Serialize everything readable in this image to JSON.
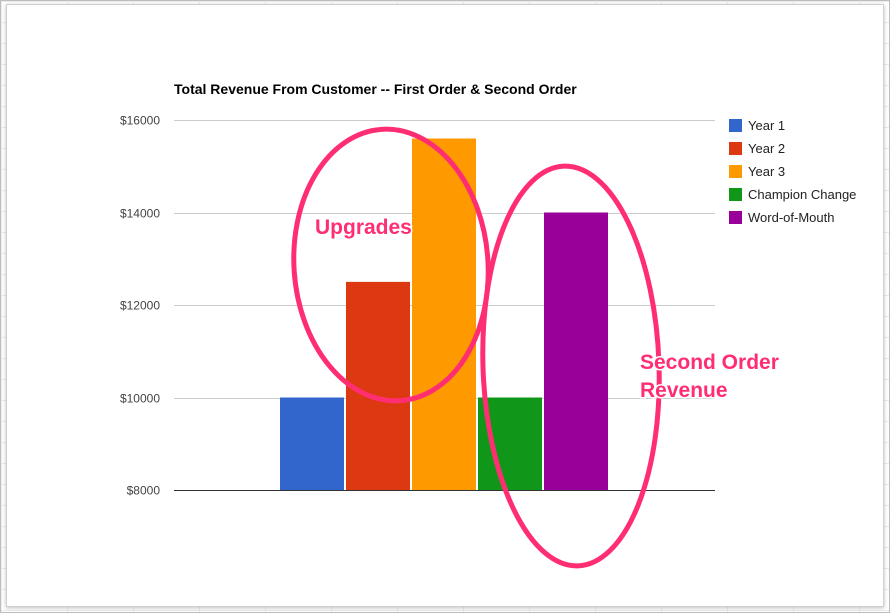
{
  "chart_data": {
    "type": "bar",
    "title": "Total Revenue From Customer -- First Order & Second Order",
    "xlabel": "",
    "ylabel": "",
    "ylim": [
      8000,
      16000
    ],
    "yticks": [
      8000,
      10000,
      12000,
      14000,
      16000
    ],
    "ytick_labels": [
      "$8000",
      "$10000",
      "$12000",
      "$14000",
      "$16000"
    ],
    "grid": true,
    "legend_position": "right",
    "series": [
      {
        "name": "Year 1",
        "value": 10000,
        "color": "#3366cc"
      },
      {
        "name": "Year 2",
        "value": 12500,
        "color": "#dc3912"
      },
      {
        "name": "Year 3",
        "value": 15600,
        "color": "#ff9900"
      },
      {
        "name": "Champion Change",
        "value": 10000,
        "color": "#109618"
      },
      {
        "name": "Word-of-Mouth",
        "value": 14000,
        "color": "#990099"
      }
    ],
    "annotations": [
      {
        "text": "Upgrades",
        "lines": [
          "Upgrades"
        ],
        "color": "#ff2e73"
      },
      {
        "text": "Second Order Revenue",
        "lines": [
          "Second Order",
          "Revenue"
        ],
        "color": "#ff2e73"
      }
    ]
  }
}
